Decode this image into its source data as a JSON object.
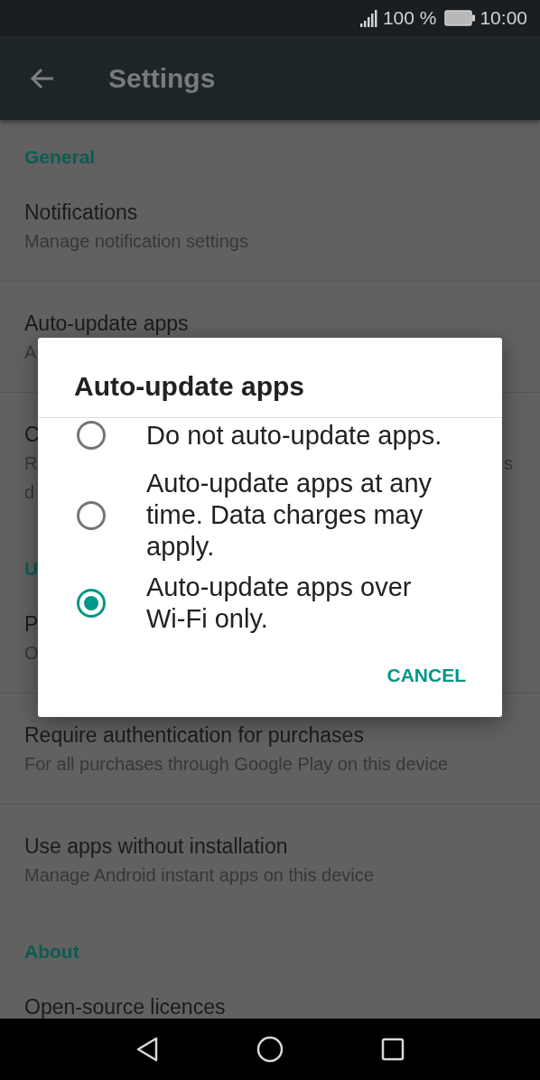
{
  "status_bar": {
    "battery_text": "100 %",
    "time": "10:00"
  },
  "app_bar": {
    "title": "Settings"
  },
  "sections": [
    {
      "header": "General",
      "items": [
        {
          "title": "Notifications",
          "subtitle_lines": [
            {
              "start": "Manage notification settings"
            }
          ]
        },
        {
          "title": "Auto-update apps",
          "subtitle_lines": [
            {
              "start": "A"
            }
          ]
        },
        {
          "title": "C",
          "subtitle_lines": [
            {
              "start": "R",
              "end": "s"
            },
            {
              "start": "d"
            }
          ]
        }
      ]
    },
    {
      "header": "U",
      "items": [
        {
          "title": "P",
          "subtitle_lines": [
            {
              "start": "O"
            }
          ]
        },
        {
          "title": "Require authentication for purchases",
          "subtitle_lines": [
            {
              "start": "For all purchases through Google Play on this device"
            }
          ]
        },
        {
          "title": "Use apps without installation",
          "subtitle_lines": [
            {
              "start": "Manage Android instant apps on this device"
            }
          ]
        }
      ]
    },
    {
      "header": "About",
      "items": [
        {
          "title": "Open-source licences"
        }
      ]
    }
  ],
  "dialog": {
    "title": "Auto-update apps",
    "options": [
      {
        "label": "Do not auto-update apps.",
        "selected": false
      },
      {
        "label": "Auto-update apps at any time. Data charges may apply.",
        "selected": false
      },
      {
        "label": "Auto-update apps over Wi-Fi only.",
        "selected": true
      }
    ],
    "buttons": [
      "CANCEL"
    ]
  }
}
